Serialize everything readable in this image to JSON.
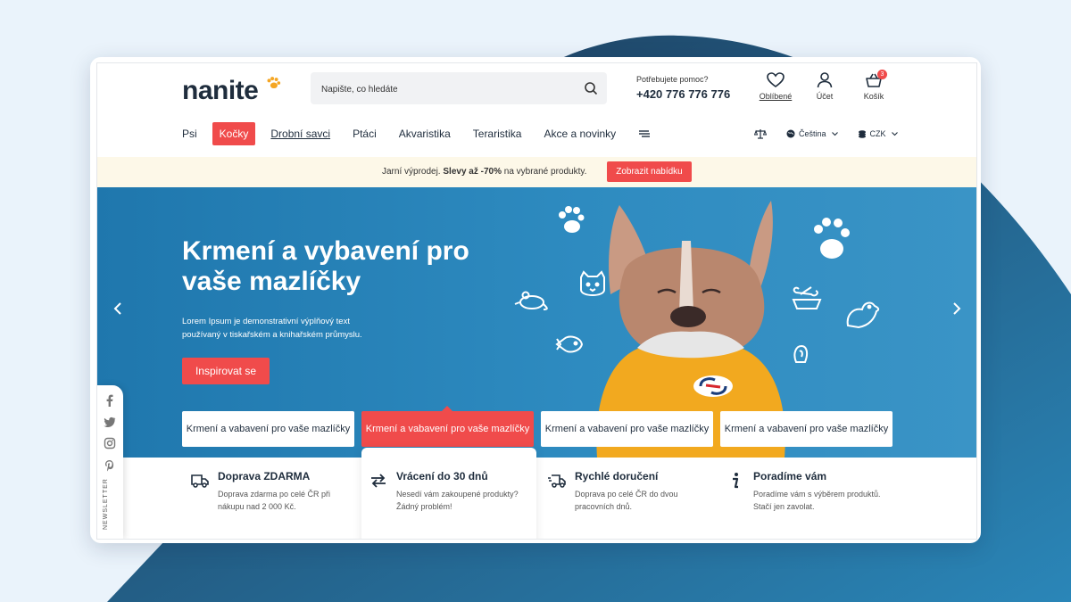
{
  "header": {
    "logo": "nanite",
    "search_placeholder": "Napište, co hledáte",
    "help_label": "Potřebujete pomoc?",
    "phone": "+420 776 776 776",
    "favorites_label": "Oblíbené",
    "account_label": "Účet",
    "cart_label": "Košík",
    "cart_count": "3"
  },
  "nav": {
    "items": [
      "Psi",
      "Kočky",
      "Drobní savci",
      "Ptáci",
      "Akvaristika",
      "Teraristika",
      "Akce a novinky"
    ],
    "language": "Čeština",
    "currency": "CZK"
  },
  "promo": {
    "text_before": "Jarní výprodej. ",
    "text_bold": "Slevy až -70%",
    "text_after": " na vybrané produkty.",
    "button": "Zobrazit nabídku"
  },
  "hero": {
    "title": "Krmení a vybavení pro vaše mazlíčky",
    "subtitle": "Lorem Ipsum je demonstrativní výplňový text používaný v tiskařském a knihařském průmyslu.",
    "button": "Inspirovat se",
    "cards": [
      "Krmení a vabavení pro vaše mazlíčky",
      "Krmení a vabavení pro vaše mazlíčky",
      "Krmení a vabavení pro vaše mazlíčky",
      "Krmení a vabavení pro vaše mazlíčky"
    ]
  },
  "social": {
    "newsletter": "NEWSLETTER"
  },
  "features": [
    {
      "title": "Doprava ZDARMA",
      "text": "Doprava zdarma po celé ČR při nákupu nad 2 000 Kč."
    },
    {
      "title": "Vrácení do 30 dnů",
      "text": "Nesedí vám zakoupené produkty? Žádný problém!"
    },
    {
      "title": "Rychlé doručení",
      "text": "Doprava po celé ČR do dvou pracovních dnů."
    },
    {
      "title": "Poradíme vám",
      "text": "Poradíme vám s výběrem produktů. Stačí jen zavolat."
    }
  ],
  "colors": {
    "accent": "#f04b4b",
    "hero": "#2e8bc0",
    "dark": "#1f2d3d",
    "promo_bg": "#fdf8e8"
  }
}
